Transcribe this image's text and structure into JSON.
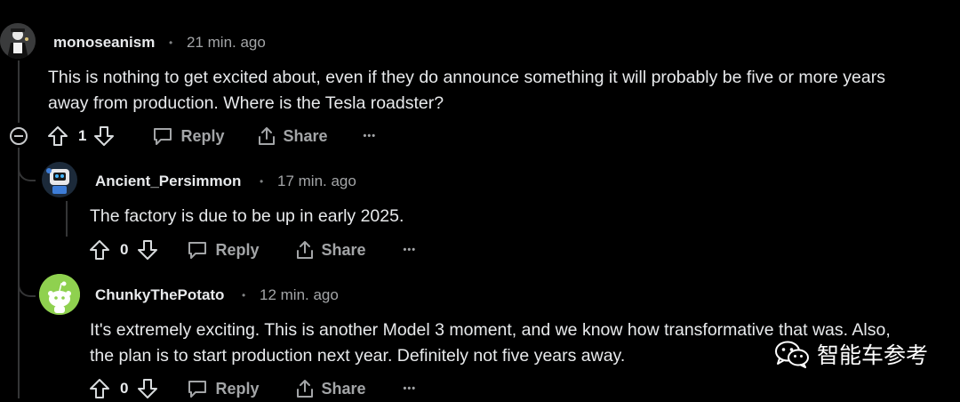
{
  "comments": [
    {
      "author": "monoseanism",
      "time": "21 min. ago",
      "lines": [
        "This is nothing to get excited about, even if they do announce something it will probably be five or more years",
        "away from production. Where is the Tesla roadster?"
      ],
      "votes": "1",
      "reply_label": "Reply",
      "share_label": "Share",
      "more_label": "•••"
    },
    {
      "author": "Ancient_Persimmon",
      "time": "17 min. ago",
      "lines": [
        "The factory is due to be up in early 2025."
      ],
      "votes": "0",
      "reply_label": "Reply",
      "share_label": "Share",
      "more_label": "•••"
    },
    {
      "author": "ChunkyThePotato",
      "time": "12 min. ago",
      "lines": [
        "It's extremely exciting. This is another Model 3 moment, and we know how transformative that was. Also,",
        "the plan is to start production next year. Definitely not five years away."
      ],
      "votes": "0",
      "reply_label": "Reply",
      "share_label": "Share",
      "more_label": "•••"
    }
  ],
  "separator": "•",
  "watermark": {
    "text": "智能车参考",
    "icon": "wechat-icon"
  },
  "colors": {
    "background": "#000000",
    "text": "#e8eaec",
    "muted": "#a3a5a7",
    "thread_line": "#343536",
    "avatar_green": "#8fd14f"
  }
}
